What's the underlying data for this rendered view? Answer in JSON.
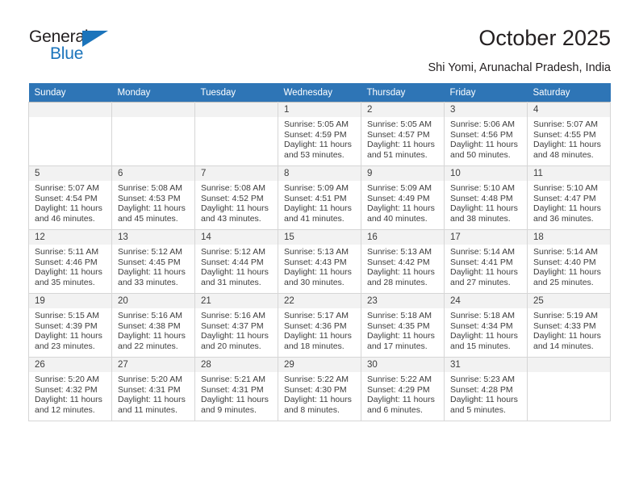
{
  "brand": {
    "name_top": "General",
    "name_bottom": "Blue",
    "accent_color": "#1b74bb",
    "triangle_icon": "triangle-icon"
  },
  "header": {
    "title": "October 2025",
    "subtitle": "Shi Yomi, Arunachal Pradesh, India"
  },
  "calendar": {
    "header_bg": "#2e75b6",
    "daynum_bg": "#f2f2f2",
    "weekdays": [
      "Sunday",
      "Monday",
      "Tuesday",
      "Wednesday",
      "Thursday",
      "Friday",
      "Saturday"
    ],
    "weeks": [
      [
        {
          "day": "",
          "sunrise": "",
          "sunset": "",
          "daylight1": "",
          "daylight2": "",
          "empty": true
        },
        {
          "day": "",
          "sunrise": "",
          "sunset": "",
          "daylight1": "",
          "daylight2": "",
          "empty": true
        },
        {
          "day": "",
          "sunrise": "",
          "sunset": "",
          "daylight1": "",
          "daylight2": "",
          "empty": true
        },
        {
          "day": "1",
          "sunrise": "Sunrise: 5:05 AM",
          "sunset": "Sunset: 4:59 PM",
          "daylight1": "Daylight: 11 hours",
          "daylight2": "and 53 minutes."
        },
        {
          "day": "2",
          "sunrise": "Sunrise: 5:05 AM",
          "sunset": "Sunset: 4:57 PM",
          "daylight1": "Daylight: 11 hours",
          "daylight2": "and 51 minutes."
        },
        {
          "day": "3",
          "sunrise": "Sunrise: 5:06 AM",
          "sunset": "Sunset: 4:56 PM",
          "daylight1": "Daylight: 11 hours",
          "daylight2": "and 50 minutes."
        },
        {
          "day": "4",
          "sunrise": "Sunrise: 5:07 AM",
          "sunset": "Sunset: 4:55 PM",
          "daylight1": "Daylight: 11 hours",
          "daylight2": "and 48 minutes."
        }
      ],
      [
        {
          "day": "5",
          "sunrise": "Sunrise: 5:07 AM",
          "sunset": "Sunset: 4:54 PM",
          "daylight1": "Daylight: 11 hours",
          "daylight2": "and 46 minutes."
        },
        {
          "day": "6",
          "sunrise": "Sunrise: 5:08 AM",
          "sunset": "Sunset: 4:53 PM",
          "daylight1": "Daylight: 11 hours",
          "daylight2": "and 45 minutes."
        },
        {
          "day": "7",
          "sunrise": "Sunrise: 5:08 AM",
          "sunset": "Sunset: 4:52 PM",
          "daylight1": "Daylight: 11 hours",
          "daylight2": "and 43 minutes."
        },
        {
          "day": "8",
          "sunrise": "Sunrise: 5:09 AM",
          "sunset": "Sunset: 4:51 PM",
          "daylight1": "Daylight: 11 hours",
          "daylight2": "and 41 minutes."
        },
        {
          "day": "9",
          "sunrise": "Sunrise: 5:09 AM",
          "sunset": "Sunset: 4:49 PM",
          "daylight1": "Daylight: 11 hours",
          "daylight2": "and 40 minutes."
        },
        {
          "day": "10",
          "sunrise": "Sunrise: 5:10 AM",
          "sunset": "Sunset: 4:48 PM",
          "daylight1": "Daylight: 11 hours",
          "daylight2": "and 38 minutes."
        },
        {
          "day": "11",
          "sunrise": "Sunrise: 5:10 AM",
          "sunset": "Sunset: 4:47 PM",
          "daylight1": "Daylight: 11 hours",
          "daylight2": "and 36 minutes."
        }
      ],
      [
        {
          "day": "12",
          "sunrise": "Sunrise: 5:11 AM",
          "sunset": "Sunset: 4:46 PM",
          "daylight1": "Daylight: 11 hours",
          "daylight2": "and 35 minutes."
        },
        {
          "day": "13",
          "sunrise": "Sunrise: 5:12 AM",
          "sunset": "Sunset: 4:45 PM",
          "daylight1": "Daylight: 11 hours",
          "daylight2": "and 33 minutes."
        },
        {
          "day": "14",
          "sunrise": "Sunrise: 5:12 AM",
          "sunset": "Sunset: 4:44 PM",
          "daylight1": "Daylight: 11 hours",
          "daylight2": "and 31 minutes."
        },
        {
          "day": "15",
          "sunrise": "Sunrise: 5:13 AM",
          "sunset": "Sunset: 4:43 PM",
          "daylight1": "Daylight: 11 hours",
          "daylight2": "and 30 minutes."
        },
        {
          "day": "16",
          "sunrise": "Sunrise: 5:13 AM",
          "sunset": "Sunset: 4:42 PM",
          "daylight1": "Daylight: 11 hours",
          "daylight2": "and 28 minutes."
        },
        {
          "day": "17",
          "sunrise": "Sunrise: 5:14 AM",
          "sunset": "Sunset: 4:41 PM",
          "daylight1": "Daylight: 11 hours",
          "daylight2": "and 27 minutes."
        },
        {
          "day": "18",
          "sunrise": "Sunrise: 5:14 AM",
          "sunset": "Sunset: 4:40 PM",
          "daylight1": "Daylight: 11 hours",
          "daylight2": "and 25 minutes."
        }
      ],
      [
        {
          "day": "19",
          "sunrise": "Sunrise: 5:15 AM",
          "sunset": "Sunset: 4:39 PM",
          "daylight1": "Daylight: 11 hours",
          "daylight2": "and 23 minutes."
        },
        {
          "day": "20",
          "sunrise": "Sunrise: 5:16 AM",
          "sunset": "Sunset: 4:38 PM",
          "daylight1": "Daylight: 11 hours",
          "daylight2": "and 22 minutes."
        },
        {
          "day": "21",
          "sunrise": "Sunrise: 5:16 AM",
          "sunset": "Sunset: 4:37 PM",
          "daylight1": "Daylight: 11 hours",
          "daylight2": "and 20 minutes."
        },
        {
          "day": "22",
          "sunrise": "Sunrise: 5:17 AM",
          "sunset": "Sunset: 4:36 PM",
          "daylight1": "Daylight: 11 hours",
          "daylight2": "and 18 minutes."
        },
        {
          "day": "23",
          "sunrise": "Sunrise: 5:18 AM",
          "sunset": "Sunset: 4:35 PM",
          "daylight1": "Daylight: 11 hours",
          "daylight2": "and 17 minutes."
        },
        {
          "day": "24",
          "sunrise": "Sunrise: 5:18 AM",
          "sunset": "Sunset: 4:34 PM",
          "daylight1": "Daylight: 11 hours",
          "daylight2": "and 15 minutes."
        },
        {
          "day": "25",
          "sunrise": "Sunrise: 5:19 AM",
          "sunset": "Sunset: 4:33 PM",
          "daylight1": "Daylight: 11 hours",
          "daylight2": "and 14 minutes."
        }
      ],
      [
        {
          "day": "26",
          "sunrise": "Sunrise: 5:20 AM",
          "sunset": "Sunset: 4:32 PM",
          "daylight1": "Daylight: 11 hours",
          "daylight2": "and 12 minutes."
        },
        {
          "day": "27",
          "sunrise": "Sunrise: 5:20 AM",
          "sunset": "Sunset: 4:31 PM",
          "daylight1": "Daylight: 11 hours",
          "daylight2": "and 11 minutes."
        },
        {
          "day": "28",
          "sunrise": "Sunrise: 5:21 AM",
          "sunset": "Sunset: 4:31 PM",
          "daylight1": "Daylight: 11 hours",
          "daylight2": "and 9 minutes."
        },
        {
          "day": "29",
          "sunrise": "Sunrise: 5:22 AM",
          "sunset": "Sunset: 4:30 PM",
          "daylight1": "Daylight: 11 hours",
          "daylight2": "and 8 minutes."
        },
        {
          "day": "30",
          "sunrise": "Sunrise: 5:22 AM",
          "sunset": "Sunset: 4:29 PM",
          "daylight1": "Daylight: 11 hours",
          "daylight2": "and 6 minutes."
        },
        {
          "day": "31",
          "sunrise": "Sunrise: 5:23 AM",
          "sunset": "Sunset: 4:28 PM",
          "daylight1": "Daylight: 11 hours",
          "daylight2": "and 5 minutes."
        },
        {
          "day": "",
          "sunrise": "",
          "sunset": "",
          "daylight1": "",
          "daylight2": "",
          "empty": true
        }
      ]
    ]
  }
}
